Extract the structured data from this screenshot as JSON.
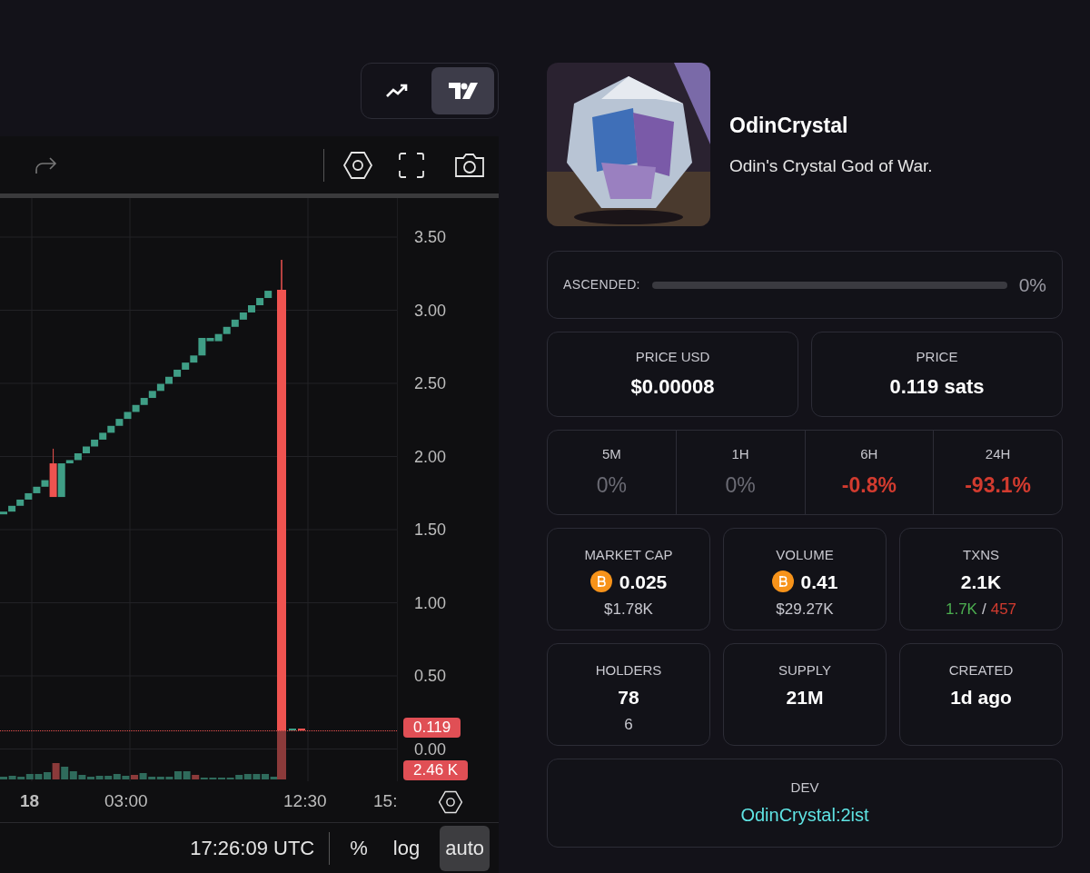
{
  "chart_toggle": [
    {
      "kind": "line",
      "selected": false
    },
    {
      "kind": "candles",
      "selected": true
    }
  ],
  "price_axis": [
    "3.50",
    "3.00",
    "2.50",
    "2.00",
    "1.50",
    "1.00",
    "0.50",
    "0.00"
  ],
  "last_price": "0.119",
  "last_volume": "2.46 K",
  "time_axis": [
    {
      "label": "18",
      "bold": true
    },
    {
      "label": "03:00",
      "bold": false
    },
    {
      "label": "12:30",
      "bold": false
    },
    {
      "label": "15:",
      "bold": false
    }
  ],
  "clock": "17:26:09 UTC",
  "scale_buttons": [
    {
      "label": "%",
      "selected": false
    },
    {
      "label": "log",
      "selected": false
    },
    {
      "label": "auto",
      "selected": true
    }
  ],
  "token": {
    "name": "OdinCrystal",
    "description": "Odin's Crystal God of War."
  },
  "ascended": {
    "label": "ASCENDED:",
    "level": 0,
    "reading": "0%"
  },
  "prices": [
    {
      "label": "PRICE USD",
      "value": "$0.00008"
    },
    {
      "label": "PRICE",
      "value": "0.119 sats"
    }
  ],
  "changes": [
    {
      "label": "5M",
      "value": "0%",
      "kind": "flat"
    },
    {
      "label": "1H",
      "value": "0%",
      "kind": "flat"
    },
    {
      "label": "6H",
      "value": "-0.8%",
      "kind": "down"
    },
    {
      "label": "24H",
      "value": "-93.1%",
      "kind": "down"
    }
  ],
  "stats": [
    {
      "kind": "btc",
      "label": "MARKET CAP",
      "value": "0.025",
      "sub": "$1.78K"
    },
    {
      "kind": "btc",
      "label": "VOLUME",
      "value": "0.41",
      "sub": "$29.27K"
    },
    {
      "kind": "split",
      "label": "TXNS",
      "value": "2.1K",
      "buys": "1.7K",
      "sep": "/",
      "sells": "457"
    },
    {
      "kind": "plain",
      "label": "HOLDERS",
      "value": "78",
      "sub": "6"
    },
    {
      "kind": "plain",
      "label": "SUPPLY",
      "value": "21M"
    },
    {
      "kind": "plain",
      "label": "CREATED",
      "value": "1d ago"
    }
  ],
  "dev": {
    "label": "DEV",
    "link": "OdinCrystal:2ist"
  }
}
